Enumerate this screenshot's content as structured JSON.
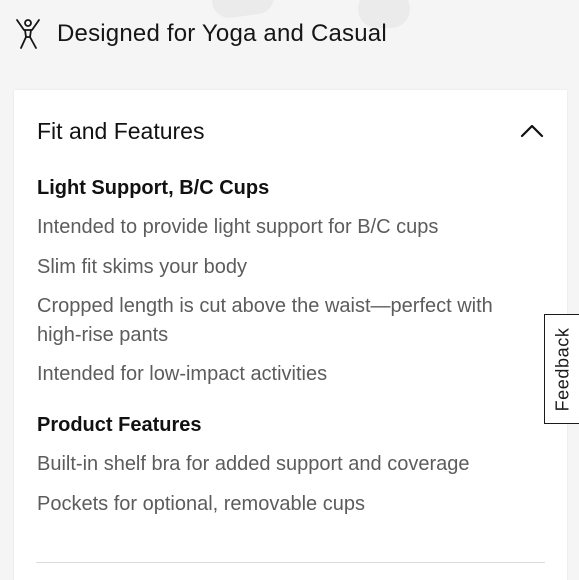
{
  "activity": {
    "icon": "person-stretching-icon",
    "label": "Designed for Yoga and Casual"
  },
  "accordion": {
    "title": "Fit and Features",
    "expanded": true,
    "toggle_icon": "chevron-up-icon",
    "sections": [
      {
        "title": "Light Support, B/C Cups",
        "items": [
          "Intended to provide light support for B/C cups",
          "Slim fit skims your body",
          "Cropped length is cut above the waist—perfect with high-rise pants",
          "Intended for low-impact activities"
        ]
      },
      {
        "title": "Product Features",
        "items": [
          "Built-in shelf bra for added support and coverage",
          "Pockets for optional, removable cups"
        ]
      }
    ]
  },
  "feedback": {
    "label": "Feedback"
  }
}
